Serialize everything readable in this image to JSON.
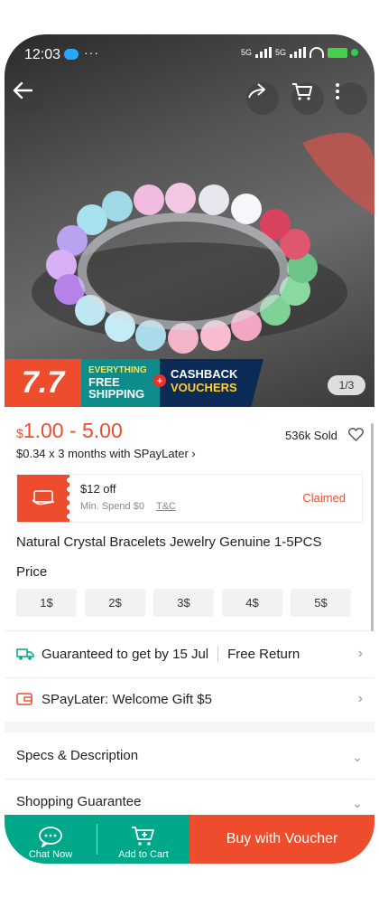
{
  "status_bar": {
    "time": "12:03",
    "dots": "···",
    "network_label": "5G"
  },
  "hero": {
    "page_indicator": "1/3"
  },
  "promo": {
    "big": "7.7",
    "free_line1": "EVERYTHING",
    "free_line2": "FREE",
    "free_line3": "SHIPPING",
    "plus": "+",
    "cash_line1": "CASHBACK",
    "cash_line2": "VOUCHERS"
  },
  "product": {
    "currency_symbol": "$",
    "price_range": "1.00 - 5.00",
    "sold": "536k Sold",
    "installment": "$0.34 x 3 months with SPayLater ›",
    "title": "Natural Crystal Bracelets Jewelry Genuine 1-5PCS"
  },
  "voucher": {
    "title": "$12 off",
    "min_spend": "Min. Spend $0",
    "tnc": "T&C",
    "status": "Claimed"
  },
  "price_options": {
    "label": "Price",
    "options": [
      "1$",
      "2$",
      "3$",
      "4$",
      "5$"
    ]
  },
  "shipping": {
    "guarantee": "Guaranteed to get by 15 Jul",
    "free_return": "Free Return"
  },
  "spaylater": {
    "text": "SPayLater: Welcome Gift $5"
  },
  "sections": {
    "specs": "Specs & Description",
    "guarantee": "Shopping Guarantee"
  },
  "bottom_bar": {
    "chat": "Chat Now",
    "add_cart": "Add to Cart",
    "buy": "Buy with Voucher"
  },
  "colors": {
    "brand_orange": "#ee4d2d",
    "teal": "#00a88a",
    "navy": "#0b2a55"
  },
  "icons": [
    "back-arrow-icon",
    "share-icon",
    "cart-icon",
    "more-icon",
    "heart-icon",
    "voucher-icon",
    "truck-icon",
    "wallet-icon",
    "chevron-right-icon",
    "chevron-down-icon",
    "chat-icon",
    "add-cart-icon"
  ]
}
